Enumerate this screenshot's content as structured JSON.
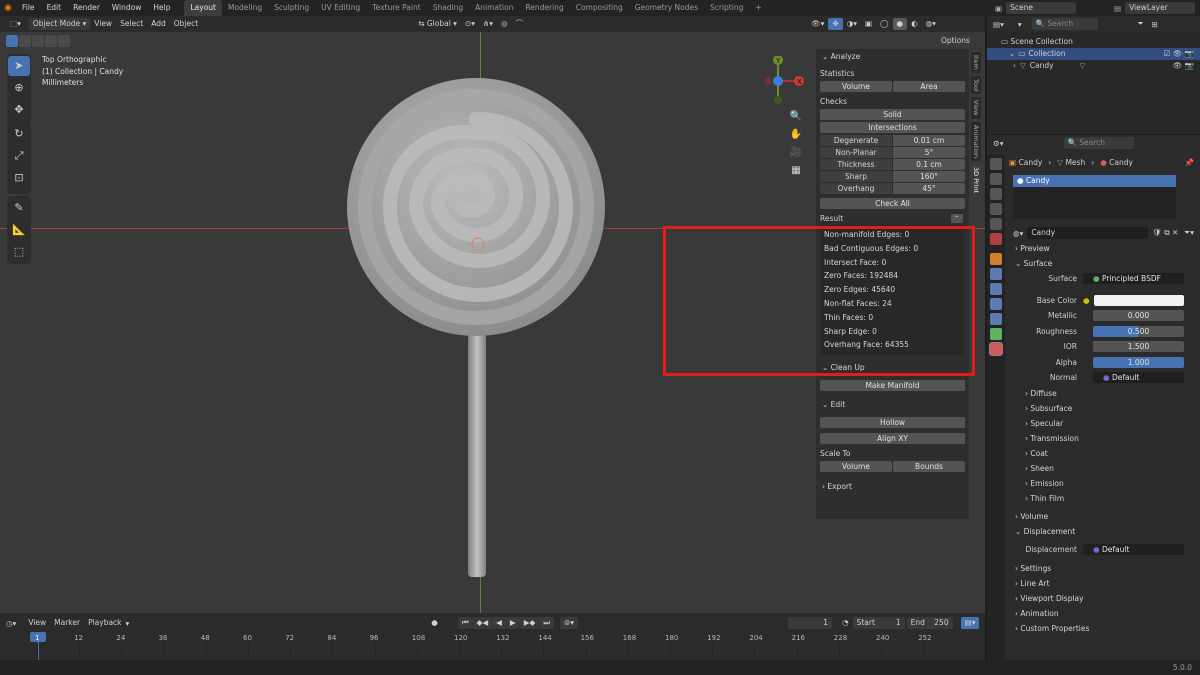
{
  "menu": [
    "File",
    "Edit",
    "Render",
    "Window",
    "Help"
  ],
  "workspaces": [
    "Layout",
    "Modeling",
    "Sculpting",
    "UV Editing",
    "Texture Paint",
    "Shading",
    "Animation",
    "Rendering",
    "Compositing",
    "Geometry Nodes",
    "Scripting"
  ],
  "active_workspace": "Layout",
  "scene_name": "Scene",
  "view_layer": "ViewLayer",
  "vp_header": {
    "mode": "Object Mode",
    "menus": [
      "View",
      "Select",
      "Add",
      "Object"
    ],
    "transform": "Global",
    "options": "Options"
  },
  "vp_overlay": {
    "view_name": "Top Orthographic",
    "collection": "(1) Collection | Candy",
    "units": "Millimeters"
  },
  "gizmo": {
    "y": "Y",
    "x": "X"
  },
  "npanel": {
    "analyze": "Analyze",
    "statistics": "Statistics",
    "volume": "Volume",
    "area": "Area",
    "checks": "Checks",
    "solid": "Solid",
    "intersections": "Intersections",
    "check_rows": [
      {
        "k": "Degenerate",
        "v": "0.01 cm"
      },
      {
        "k": "Non-Planar",
        "v": "5°"
      },
      {
        "k": "Thickness",
        "v": "0.1 cm"
      },
      {
        "k": "Sharp",
        "v": "160°"
      },
      {
        "k": "Overhang",
        "v": "45°"
      }
    ],
    "check_all": "Check All",
    "result": "Result",
    "result_lines": [
      "Non-manifold Edges: 0",
      "Bad Contiguous Edges: 0",
      "Intersect Face: 0",
      "Zero Faces: 192484",
      "Zero Edges: 45640",
      "Non-flat Faces: 24",
      "Thin Faces: 0",
      "Sharp Edge: 0",
      "Overhang Face: 64355"
    ],
    "clean_up": "Clean Up",
    "make_manifold": "Make Manifold",
    "edit": "Edit",
    "hollow": "Hollow",
    "align_xy": "Align XY",
    "scale_to": "Scale To",
    "scale_volume": "Volume",
    "scale_bounds": "Bounds",
    "export": "Export"
  },
  "vtabs": [
    "Item",
    "Tool",
    "View",
    "Animation",
    "3D Print"
  ],
  "timeline": {
    "menus": [
      "View",
      "Marker",
      "Playback"
    ],
    "current_frame": "1",
    "start_label": "Start",
    "start": "1",
    "end_label": "End",
    "end": "250",
    "frames": [
      "1",
      "12",
      "24",
      "36",
      "48",
      "60",
      "72",
      "84",
      "96",
      "108",
      "120",
      "132",
      "144",
      "156",
      "168",
      "180",
      "192",
      "204",
      "216",
      "228",
      "240",
      "252"
    ]
  },
  "outliner": {
    "search_placeholder": "Search",
    "scene_collection": "Scene Collection",
    "collection": "Collection",
    "object": "Candy"
  },
  "props": {
    "search_placeholder": "Search",
    "breadcrumb": [
      "Candy",
      "Mesh",
      "Candy"
    ],
    "material_slot": "Candy",
    "material_name": "Candy",
    "preview": "Preview",
    "surface": "Surface",
    "surface_label": "Surface",
    "surface_value": "Principled BSDF",
    "base_color_label": "Base Color",
    "base_color": "#f2f2f2",
    "metallic_label": "Metallic",
    "metallic": "0.000",
    "roughness_label": "Roughness",
    "roughness": "0.500",
    "ior_label": "IOR",
    "ior": "1.500",
    "alpha_label": "Alpha",
    "alpha": "1.000",
    "normal_label": "Normal",
    "normal_value": "Default",
    "subsections": [
      "Diffuse",
      "Subsurface",
      "Specular",
      "Transmission",
      "Coat",
      "Sheen",
      "Emission",
      "Thin Film"
    ],
    "volume": "Volume",
    "displacement": "Displacement",
    "displacement_label": "Displacement",
    "displacement_value": "Default",
    "more_sections": [
      "Settings",
      "Line Art",
      "Viewport Display",
      "Animation",
      "Custom Properties"
    ]
  },
  "version": "5.0.0",
  "colors": {
    "accent": "#4772b3",
    "highlight_box": "#e51c1c"
  }
}
